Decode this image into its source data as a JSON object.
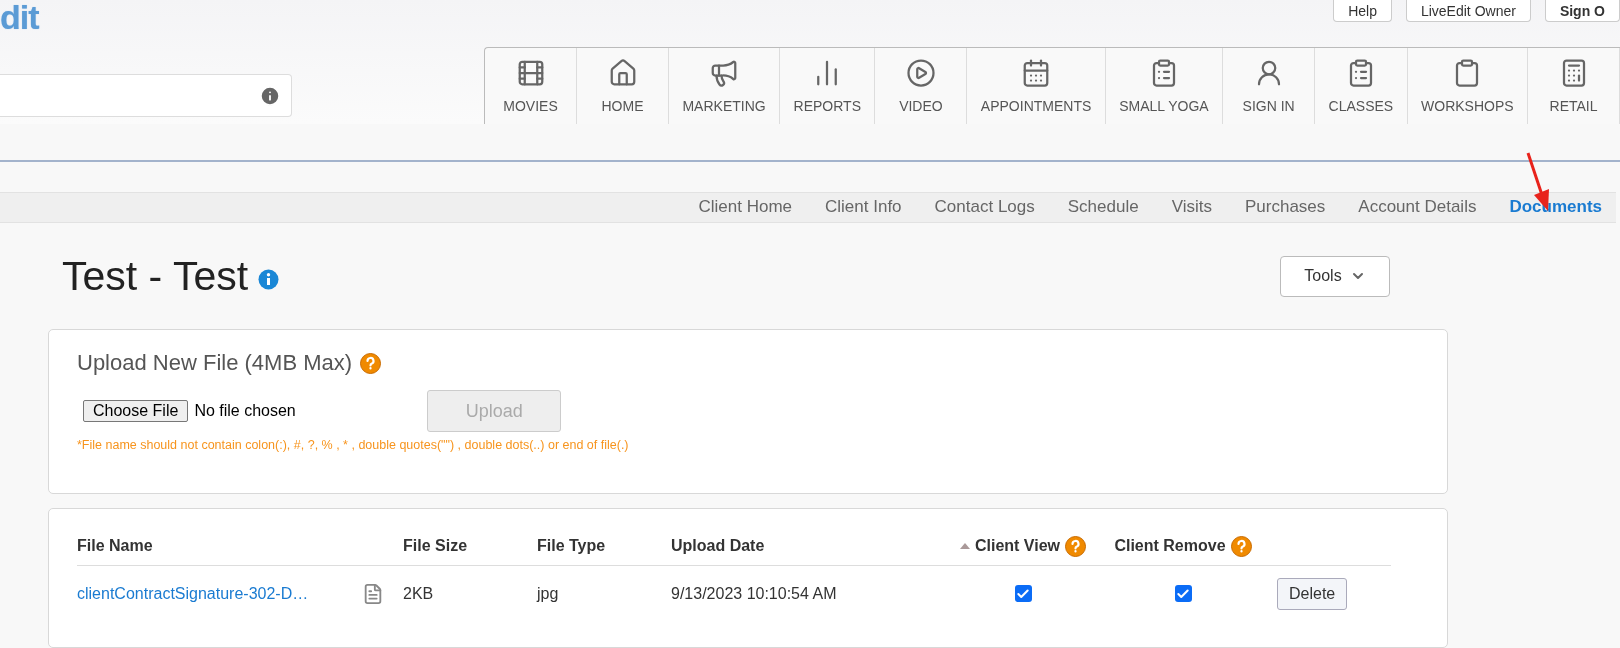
{
  "header": {
    "logo": "dit",
    "top_buttons": [
      {
        "label": "Help"
      },
      {
        "label": "LiveEdit Owner"
      },
      {
        "label": "Sign O"
      }
    ]
  },
  "nav_tabs": [
    {
      "label": "MOVIES"
    },
    {
      "label": "HOME"
    },
    {
      "label": "MARKETING"
    },
    {
      "label": "REPORTS"
    },
    {
      "label": "VIDEO"
    },
    {
      "label": "APPOINTMENTS"
    },
    {
      "label": "SMALL YOGA"
    },
    {
      "label": "SIGN IN"
    },
    {
      "label": "CLASSES"
    },
    {
      "label": "WORKSHOPS"
    },
    {
      "label": "RETAIL"
    }
  ],
  "sub_nav": [
    {
      "label": "Client Home",
      "selected": false
    },
    {
      "label": "Client Info",
      "selected": false
    },
    {
      "label": "Contact Logs",
      "selected": false
    },
    {
      "label": "Schedule",
      "selected": false
    },
    {
      "label": "Visits",
      "selected": false
    },
    {
      "label": "Purchases",
      "selected": false
    },
    {
      "label": "Account Details",
      "selected": false
    },
    {
      "label": "Documents",
      "selected": true
    }
  ],
  "page": {
    "title": "Test - Test",
    "tools_button": "Tools"
  },
  "upload": {
    "title": "Upload New File (4MB Max)",
    "choose_button": "Choose File",
    "file_status": "No file chosen",
    "upload_button": "Upload",
    "upload_disabled": true,
    "note": "*File name should not contain colon(:), #, ?, % , * , double quotes(\"\") , double dots(..) or end of file(.)"
  },
  "table": {
    "columns": [
      "File Name",
      "File Size",
      "File Type",
      "Upload Date",
      "Client View",
      "Client Remove"
    ],
    "rows": [
      {
        "file_name": "clientContractSignature-302-D…",
        "file_size": "2KB",
        "file_type": "jpg",
        "upload_date": "9/13/2023 10:10:54 AM",
        "client_view": true,
        "client_remove": true,
        "action": "Delete"
      }
    ]
  }
}
